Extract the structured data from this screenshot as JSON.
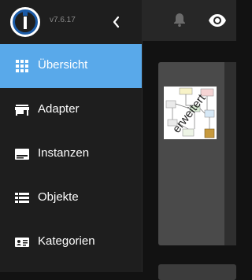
{
  "app": {
    "version": "v7.6.17"
  },
  "icons": {
    "logo": "iobroker-logo-icon",
    "collapse": "chevron-left-icon",
    "notifications": "bell-icon",
    "visibility": "eye-icon"
  },
  "colors": {
    "active": "#59a9ea",
    "sidebar": "#1e1e1e",
    "logo": "#1a5aa6"
  },
  "sidebar": {
    "items": [
      {
        "label": "Übersicht",
        "icon": "grid-icon",
        "active": true
      },
      {
        "label": "Adapter",
        "icon": "store-icon",
        "active": false
      },
      {
        "label": "Instanzen",
        "icon": "instances-icon",
        "active": false
      },
      {
        "label": "Objekte",
        "icon": "list-icon",
        "active": false
      },
      {
        "label": "Kategorien",
        "icon": "categories-icon",
        "active": false
      }
    ]
  },
  "main": {
    "card": {
      "image_text": "erweitert"
    }
  }
}
